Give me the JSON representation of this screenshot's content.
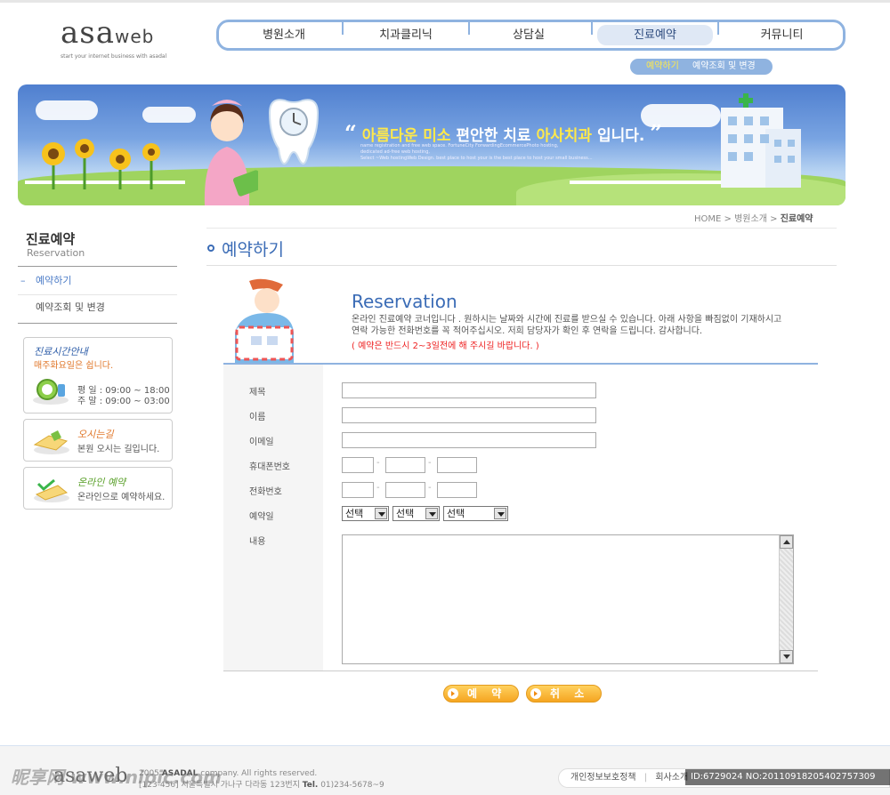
{
  "header": {
    "logo_main": "asa",
    "logo_suffix": "web",
    "logo_tagline": "start your internet business with asadal",
    "nav": [
      "병원소개",
      "치과클리닉",
      "상담실",
      "진료예약",
      "커뮤니티"
    ],
    "nav_active": "진료예약",
    "subnav": [
      "예약하기",
      "예약조회 및 변경"
    ],
    "subnav_active": "예약하기"
  },
  "banner": {
    "slogan_quote_open": "“",
    "slogan_highlight": "아름다운 미소",
    "slogan_mid": "편안한 치료",
    "slogan_brand": "아사치과",
    "slogan_end": "입니다.",
    "slogan_quote_close": "”",
    "sub_lines": [
      "name registration and free web space. FortuneCity ForwardingEcommercePhoto hosting,",
      "dedicated ad-free web hosting,",
      "Select ~Web hostingWeb Design. best place to host your is the best place to host your small business..."
    ]
  },
  "breadcrumb": {
    "items": [
      "HOME",
      "병원소개"
    ],
    "current": "진료예약",
    "sep": ">"
  },
  "sidebar": {
    "title": "진료예약",
    "subtitle": "Reservation",
    "menu": [
      {
        "label": "예약하기",
        "active": true
      },
      {
        "label": "예약조회 및 변경",
        "active": false
      }
    ],
    "hours_box": {
      "title": "진료시간안내",
      "note": "매주화요일은 쉽니다.",
      "weekday": "평 일 : 09:00 ~ 18:00",
      "weekend": "주 말 : 09:00 ~ 03:00"
    },
    "directions_box": {
      "title": "오시는길",
      "text": "본원 오시는 길입니다."
    },
    "online_box": {
      "title": "온라인 예약",
      "text": "온라인으로 예약하세요."
    }
  },
  "content": {
    "title": "예약하기",
    "intro_title": "Reservation",
    "intro_lines": [
      "온라인 진료예약 코너입니다 . 원하시는 날짜와 시간에 진료를 받으실 수 있습니다. 아래 사항을 빠짐없이 기재하시고",
      "연락 가능한 전화번호를 꼭 적어주십시오. 저희 담당자가 확인 후 연락을 드립니다. 감사합니다."
    ],
    "intro_warning": "( 예약은 반드시 2~3일전에 해 주시길 바랍니다. )",
    "form": {
      "labels": {
        "subject": "제목",
        "name": "이름",
        "email": "이메일",
        "mobile": "휴대폰번호",
        "phone": "전화번호",
        "date": "예약일",
        "content": "내용"
      },
      "phone_sep": "-",
      "selects": [
        "선택",
        "선택",
        "선택"
      ]
    },
    "buttons": {
      "submit": "예 약",
      "cancel": "취 소"
    }
  },
  "footer": {
    "logo": "asaweb",
    "copyright_year": "2005",
    "copyright_brand": "ASADAL",
    "copyright_rest": "company. All rights reserved.",
    "address": "[123-456] 서울특별시 가나구 다라동 123번지",
    "tel_label": "Tel.",
    "tel": "01)234-5678~9",
    "links": [
      "개인정보보호정책",
      "회사소개"
    ],
    "image_id": "ID:6729024 NO:20110918205402757309",
    "watermark": "昵享网 www.nipic.com"
  },
  "colors": {
    "accent": "#3b6cb6",
    "nav_border": "#8fb3e0",
    "warning": "#ee2222",
    "button": "#f5a521"
  }
}
